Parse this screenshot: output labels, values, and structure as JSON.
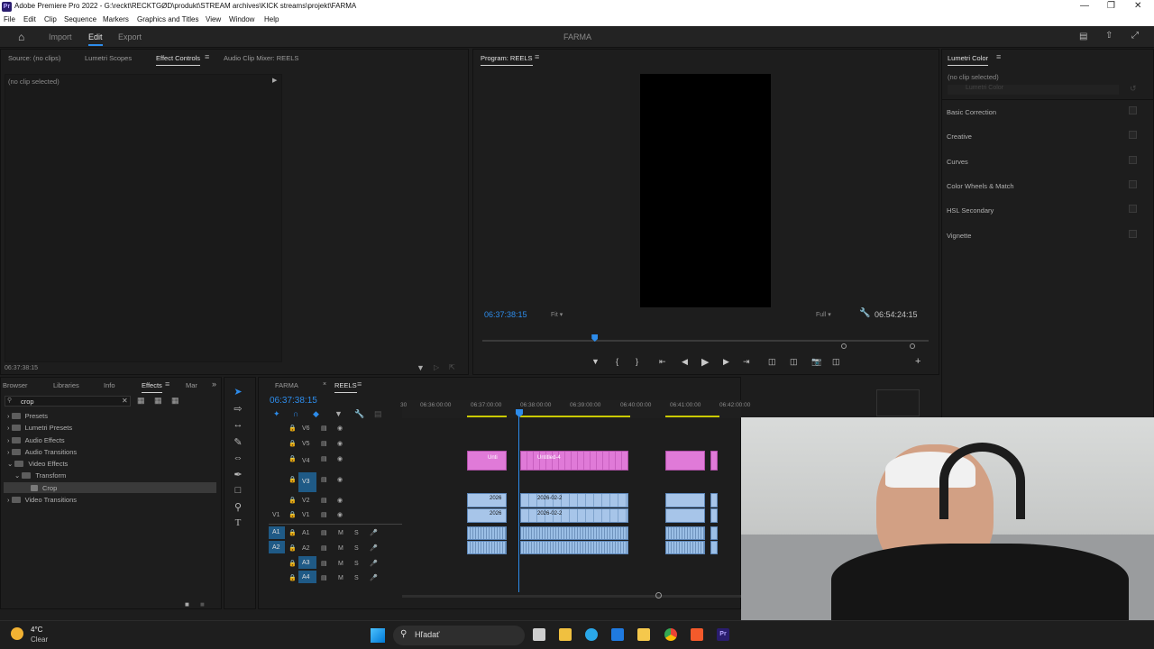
{
  "window": {
    "title": "Adobe Premiere Pro 2022 - G:\\reckt\\RECKTGØD\\produkt\\STREAM archives\\KICK streams\\projekt\\FARMA",
    "app_icon": "Pr"
  },
  "menu": [
    "File",
    "Edit",
    "Clip",
    "Sequence",
    "Markers",
    "Graphics and Titles",
    "View",
    "Window",
    "Help"
  ],
  "header": {
    "workspaces": [
      "Import",
      "Edit",
      "Export"
    ],
    "active": "Edit",
    "project_name": "FARMA"
  },
  "source_panel": {
    "tabs": [
      "Source: (no clips)",
      "Lumetri Scopes",
      "Effect Controls",
      "Audio Clip Mixer: REELS"
    ],
    "active_tab": "Effect Controls",
    "no_clip": "(no clip selected)",
    "timecode": "06:37:38:15"
  },
  "program_monitor": {
    "title": "Program: REELS",
    "timecode": "06:37:38:15",
    "fit": "Fit",
    "quality": "Full",
    "duration": "06:54:24:15",
    "playhead_fraction": 0.245
  },
  "lumetri": {
    "title": "Lumetri Color",
    "no_clip": "(no clip selected)",
    "dropdown": "Lumetri Color",
    "sections": [
      "Basic Correction",
      "Creative",
      "Curves",
      "Color Wheels & Match",
      "HSL Secondary",
      "Vignette"
    ]
  },
  "effects_panel": {
    "tabs": [
      "Browser",
      "Libraries",
      "Info",
      "Effects",
      "Mar"
    ],
    "active_tab": "Effects",
    "search_value": "crop",
    "tree": [
      {
        "label": "Presets",
        "level": 0
      },
      {
        "label": "Lumetri Presets",
        "level": 0
      },
      {
        "label": "Audio Effects",
        "level": 0
      },
      {
        "label": "Audio Transitions",
        "level": 0
      },
      {
        "label": "Video Effects",
        "level": 0
      },
      {
        "label": "Transform",
        "level": 1
      },
      {
        "label": "Crop",
        "level": 2
      },
      {
        "label": "Video Transitions",
        "level": 0
      }
    ]
  },
  "timeline": {
    "tabs": [
      "FARMA",
      "REELS"
    ],
    "active_tab": "REELS",
    "timecode": "06:37:38:15",
    "ruler": [
      "30",
      "06:36:00:00",
      "06:37:00:00",
      "06:38:00:00",
      "06:39:00:00",
      "06:40:00:00",
      "06:41:00:00",
      "06:42:00:00",
      "06:43:00:00",
      "06:44:00:00"
    ],
    "video_tracks": [
      "V6",
      "V5",
      "V4",
      "V3",
      "V2",
      "V1"
    ],
    "audio_tracks": [
      "A1",
      "A2",
      "A3",
      "A4"
    ],
    "source_patch": {
      "v": "V1",
      "a1": "A1",
      "a2": "A2"
    },
    "clip_labels": {
      "v4a": "Unti",
      "v4b": "Untitled-4",
      "v2a": "2026",
      "v2b": "2026-02-2",
      "v1a": "2026",
      "v1b": "2026-02-2"
    }
  },
  "taskbar": {
    "weather_temp": "4°C",
    "weather_desc": "Clear",
    "search": "Hľadať"
  },
  "colors": {
    "accent": "#2d8ceb",
    "pink_clip": "#e07ad8",
    "blue_clip": "#a7c5e9"
  }
}
